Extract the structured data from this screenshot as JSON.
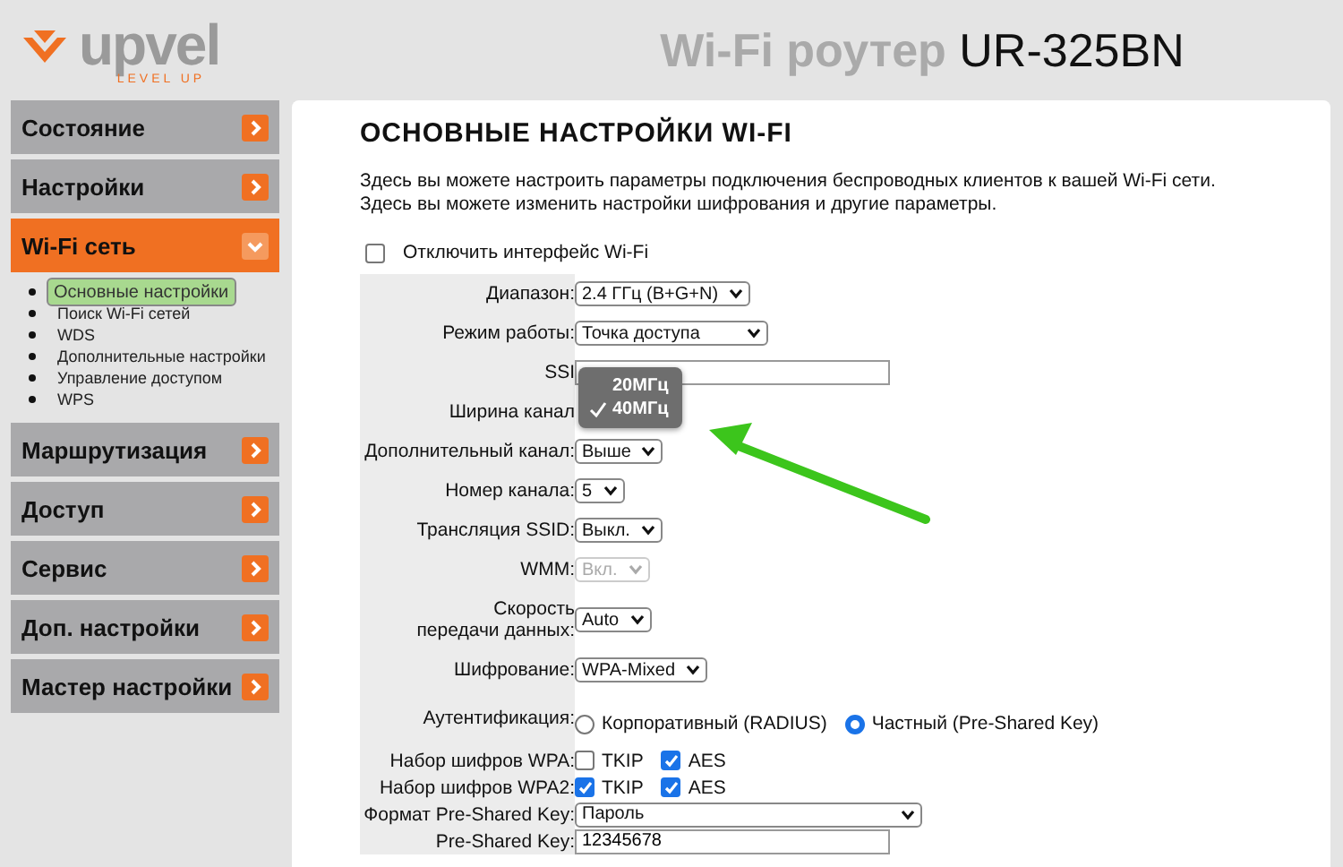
{
  "header": {
    "brand": "upvel",
    "tagline": "LEVEL UP",
    "title": "Wi-Fi роутер",
    "model": "UR-325BN"
  },
  "sidebar": {
    "items": [
      {
        "label": "Состояние",
        "expanded": false
      },
      {
        "label": "Настройки",
        "expanded": false
      },
      {
        "label": "Wi-Fi сеть",
        "expanded": true,
        "children": [
          {
            "label": "Основные настройки",
            "selected": true
          },
          {
            "label": "Поиск Wi-Fi сетей",
            "selected": false
          },
          {
            "label": "WDS",
            "selected": false
          },
          {
            "label": "Дополнительные настройки",
            "selected": false
          },
          {
            "label": "Управление доступом",
            "selected": false
          },
          {
            "label": "WPS",
            "selected": false
          }
        ]
      },
      {
        "label": "Маршрутизация",
        "expanded": false
      },
      {
        "label": "Доступ",
        "expanded": false
      },
      {
        "label": "Сервис",
        "expanded": false
      },
      {
        "label": "Доп. настройки",
        "expanded": false
      },
      {
        "label": "Мастер настройки",
        "expanded": false
      }
    ]
  },
  "content": {
    "heading": "ОСНОВНЫЕ НАСТРОЙКИ WI-FI",
    "description": [
      "Здесь вы можете настроить параметры подключения беспроводных клиентов к вашей Wi-Fi сети.",
      "Здесь вы можете изменить настройки шифрования и другие параметры."
    ],
    "disable_wifi": {
      "label": "Отключить интерфейс Wi-Fi",
      "checked": false
    },
    "fields": [
      {
        "kind": "select",
        "label": "Диапазон:",
        "value": "2.4 ГГц (B+G+N)",
        "disabled": false
      },
      {
        "kind": "select",
        "label": "Режим работы:",
        "value": "Точка доступа",
        "disabled": false
      },
      {
        "kind": "text",
        "label": "SSI"
      },
      {
        "kind": "open_select",
        "label": "Ширина канал",
        "options": [
          {
            "label": "20МГц",
            "selected": false
          },
          {
            "label": "40МГц",
            "selected": true
          }
        ]
      },
      {
        "kind": "select",
        "label": "Дополнительный канал:",
        "value": "Выше",
        "disabled": false
      },
      {
        "kind": "select",
        "label": "Номер канала:",
        "value": "5",
        "disabled": false
      },
      {
        "kind": "select",
        "label": "Трансляция SSID:",
        "value": "Выкл.",
        "disabled": false
      },
      {
        "kind": "select",
        "label": "WMM:",
        "value": "Вкл.",
        "disabled": true
      },
      {
        "kind": "select",
        "label": "Скорость передачи данных:",
        "value": "Auto",
        "disabled": false
      },
      {
        "kind": "select",
        "label": "Шифрование:",
        "value": "WPA-Mixed",
        "disabled": false
      },
      {
        "kind": "radios",
        "label": "Аутентификация:",
        "options": [
          {
            "label": "Корпоративный (RADIUS)",
            "selected": false
          },
          {
            "label": "Частный (Pre-Shared Key)",
            "selected": true
          }
        ]
      },
      {
        "kind": "checks",
        "label": "Набор шифров WPA:",
        "options": [
          {
            "label": "TKIP",
            "checked": false
          },
          {
            "label": "AES",
            "checked": true
          }
        ]
      },
      {
        "kind": "checks",
        "label": "Набор шифров WPA2:",
        "options": [
          {
            "label": "TKIP",
            "checked": true
          },
          {
            "label": "AES",
            "checked": true
          }
        ]
      },
      {
        "kind": "select",
        "label": "Формат Pre-Shared Key:",
        "value": "Пароль",
        "disabled": false
      },
      {
        "kind": "text",
        "label": "Pre-Shared Key:",
        "value": "12345678"
      }
    ]
  }
}
